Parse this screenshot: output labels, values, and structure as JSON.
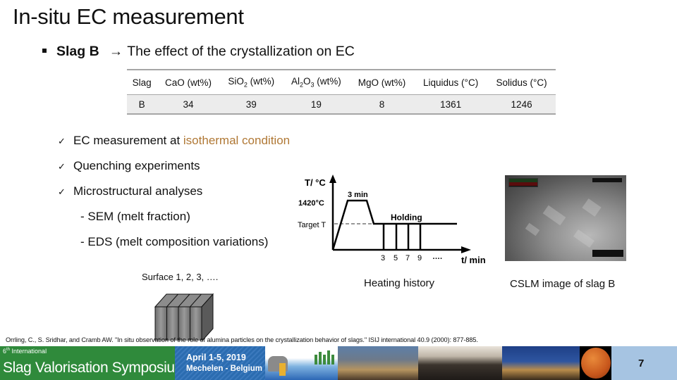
{
  "slide": {
    "title": "In-situ EC measurement",
    "subtitle": {
      "bold": "Slag B",
      "arrow": "→",
      "text": "The effect of the crystallization on EC"
    }
  },
  "composition_table": {
    "headers": [
      {
        "main": "Slag",
        "sub": "",
        "rest": ""
      },
      {
        "main": "CaO (wt%)",
        "sub": "",
        "rest": ""
      },
      {
        "main": "SiO",
        "sub": "2",
        "rest": " (wt%)"
      },
      {
        "main": "Al",
        "sub": "2",
        "rest": "O",
        "sub2": "3",
        "rest2": " (wt%)"
      },
      {
        "main": "MgO (wt%)",
        "sub": "",
        "rest": ""
      },
      {
        "main": "Liquidus (°C)",
        "sub": "",
        "rest": ""
      },
      {
        "main": "Solidus (°C)",
        "sub": "",
        "rest": ""
      }
    ],
    "rows": [
      [
        "B",
        "34",
        "39",
        "19",
        "8",
        "1361",
        "1246"
      ]
    ]
  },
  "checklist": [
    {
      "text": "EC measurement at ",
      "accent": "isothermal condition"
    },
    {
      "text": "Quenching experiments",
      "accent": ""
    },
    {
      "text": "Microstructural analyses",
      "accent": ""
    }
  ],
  "sub_items": [
    "- SEM (melt fraction)",
    "- EDS (melt composition variations)"
  ],
  "check_glyph": "✓",
  "accent_color": "#b07835",
  "surface_label": "Surface 1, 2, 3, ….",
  "heating_diagram": {
    "y_label": "T/ °C",
    "x_label": "t/ min",
    "peak_label": "1420°C",
    "target_label": "Target T",
    "peak_hold_label": "3 min",
    "holding_label": "Holding",
    "quench_times": [
      "3",
      "5",
      "7",
      "9"
    ],
    "ellipsis": "….",
    "caption": "Heating history"
  },
  "cslm": {
    "caption": "CSLM image of slag B"
  },
  "reference": "Orrling, C., S. Sridhar, and Cramb AW. \"In situ observation of the role of alumina particles on the crystallization behavior of slags.\" ISIJ international 40.9 (2000): 877-885.",
  "footer": {
    "edition": "6",
    "edition_suffix": "th",
    "edition_rest": " International",
    "event_name": "Slag Valorisation Symposium",
    "dates": "April 1-5, 2019",
    "location": "Mechelen - Belgium",
    "page_number": "7",
    "colors": {
      "green": "#2f8a3b",
      "blue": "#2b6cb0",
      "page_bg": "#a6c4e2"
    }
  }
}
